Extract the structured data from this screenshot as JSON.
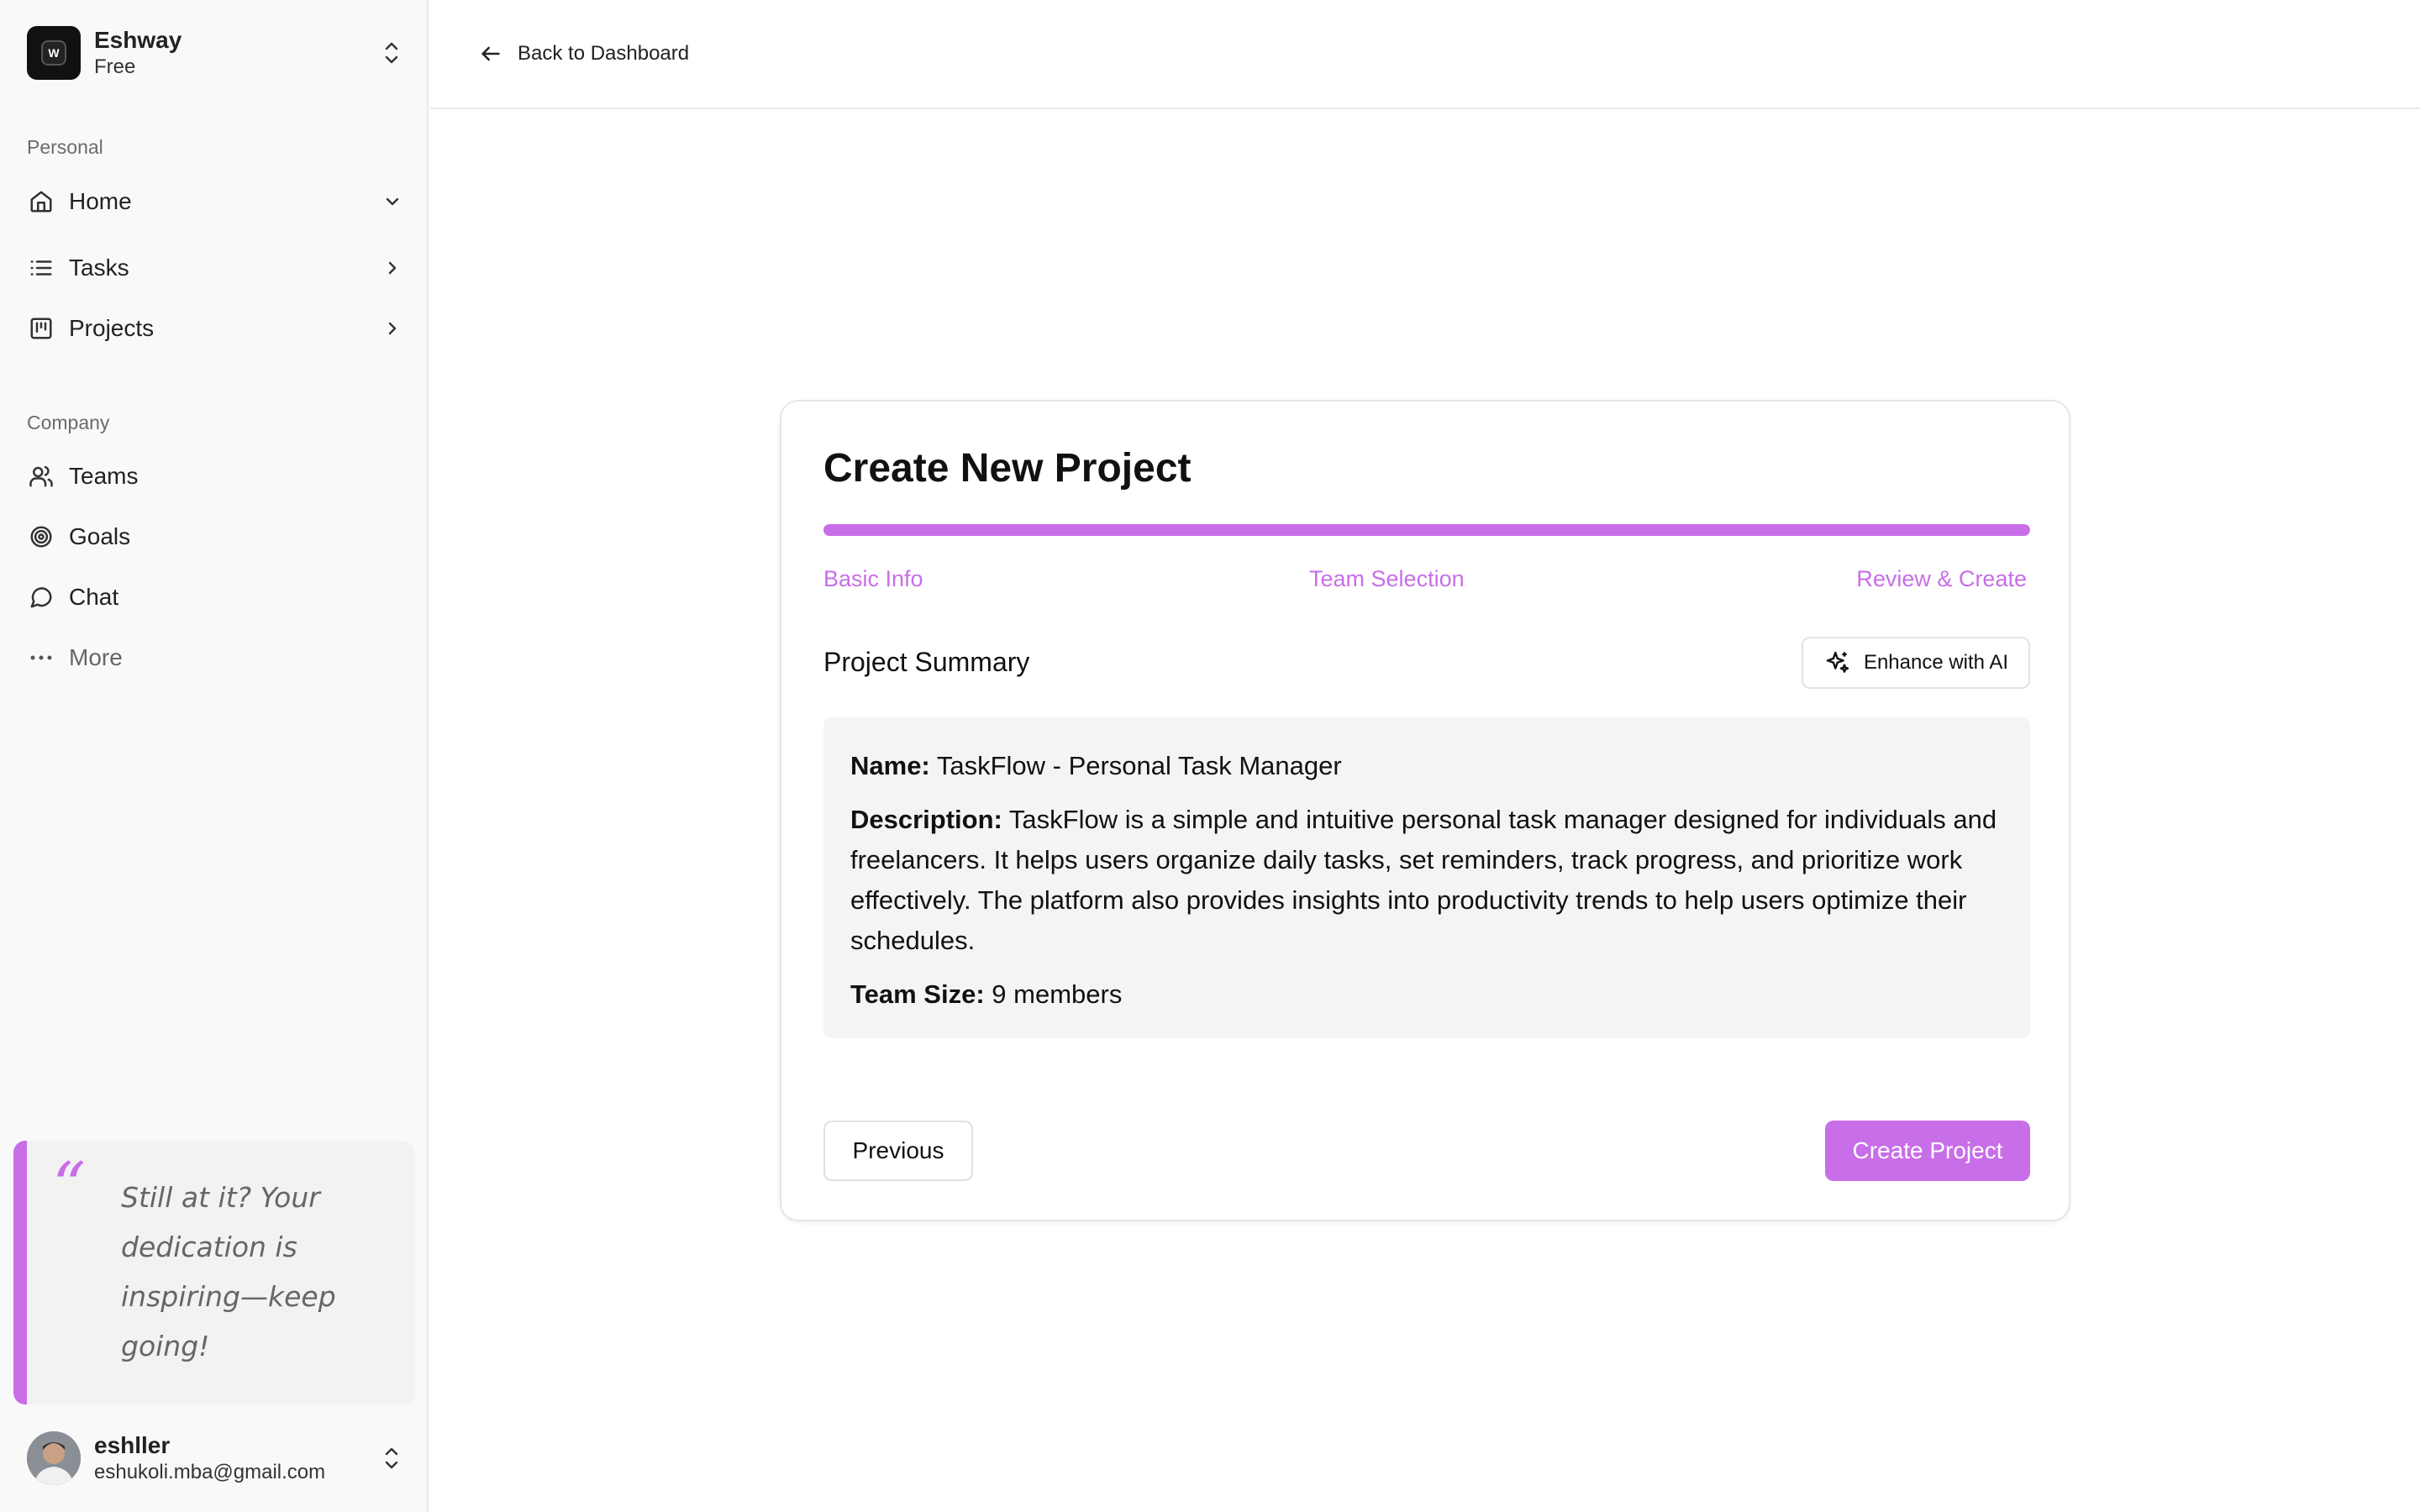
{
  "workspace": {
    "name": "Eshway",
    "plan": "Free"
  },
  "sidebar": {
    "personal_label": "Personal",
    "personal_items": [
      {
        "label": "Home",
        "icon": "home-icon"
      },
      {
        "label": "Tasks",
        "icon": "list-icon"
      },
      {
        "label": "Projects",
        "icon": "kanban-icon"
      }
    ],
    "company_label": "Company",
    "company_items": [
      {
        "label": "Teams",
        "icon": "users-icon"
      },
      {
        "label": "Goals",
        "icon": "target-icon"
      },
      {
        "label": "Chat",
        "icon": "chat-icon"
      },
      {
        "label": "More",
        "icon": "more-icon"
      }
    ],
    "quote": "Still at it? Your dedication is inspiring—keep going!"
  },
  "user": {
    "name": "eshller",
    "email": "eshukoli.mba@gmail.com"
  },
  "header": {
    "back_label": "Back to Dashboard"
  },
  "wizard": {
    "title": "Create New Project",
    "progress": 1.0,
    "steps": [
      "Basic Info",
      "Team Selection",
      "Review & Create"
    ],
    "summary_label": "Project Summary",
    "enhance_label": "Enhance with AI",
    "name_label": "Name:",
    "name_value": "TaskFlow - Personal Task Manager",
    "description_label": "Description:",
    "description_value": "TaskFlow is a simple and intuitive personal task manager designed for individuals and freelancers. It helps users organize daily tasks, set reminders, track progress, and prioritize work effectively. The platform also provides insights into productivity trends to help users optimize their schedules.",
    "team_size_label": "Team Size:",
    "team_size_value": "9 members",
    "previous_label": "Previous",
    "create_label": "Create Project"
  },
  "colors": {
    "accent": "#c86ee8",
    "sidebar_bg": "#f9f9f9",
    "summary_bg": "#f4f4f4"
  }
}
